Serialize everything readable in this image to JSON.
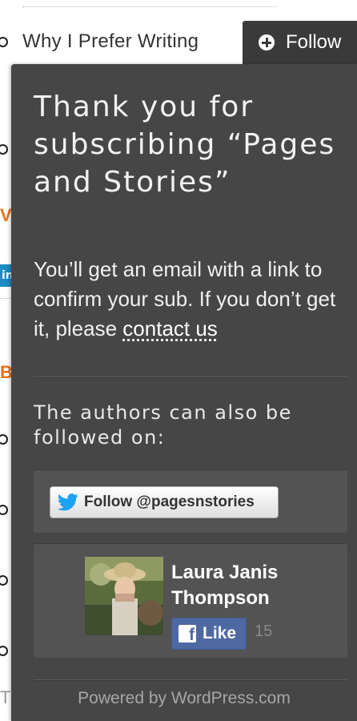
{
  "background": {
    "list_item_title": "Why I Prefer Writing",
    "orange_letter_1": "V",
    "orange_letter_2": "B",
    "linkedin_glyph": "in",
    "bottom_text": "Th"
  },
  "follow_button": {
    "label": "Follow",
    "icon": "plus-circle-icon"
  },
  "panel": {
    "title": "Thank you for subscribing “Pages and Stories”",
    "message_prefix": "You’ll get an email with a link to confirm your sub. If you don’t get it, please ",
    "contact_link": "contact us",
    "also_followed_label": "The authors can also be followed on:",
    "twitter": {
      "label": "Follow @pagesnstories",
      "icon": "twitter-bird-icon",
      "color": "#1da1f2"
    },
    "facebook": {
      "name": "Laura Janis Thompson",
      "like_label": "Like",
      "like_count": "15",
      "icon": "facebook-f-icon",
      "color": "#4e69a2"
    },
    "powered_by": "Powered by WordPress.com"
  },
  "colors": {
    "panel_bg": "#464646",
    "accent_orange": "#e8711b"
  }
}
